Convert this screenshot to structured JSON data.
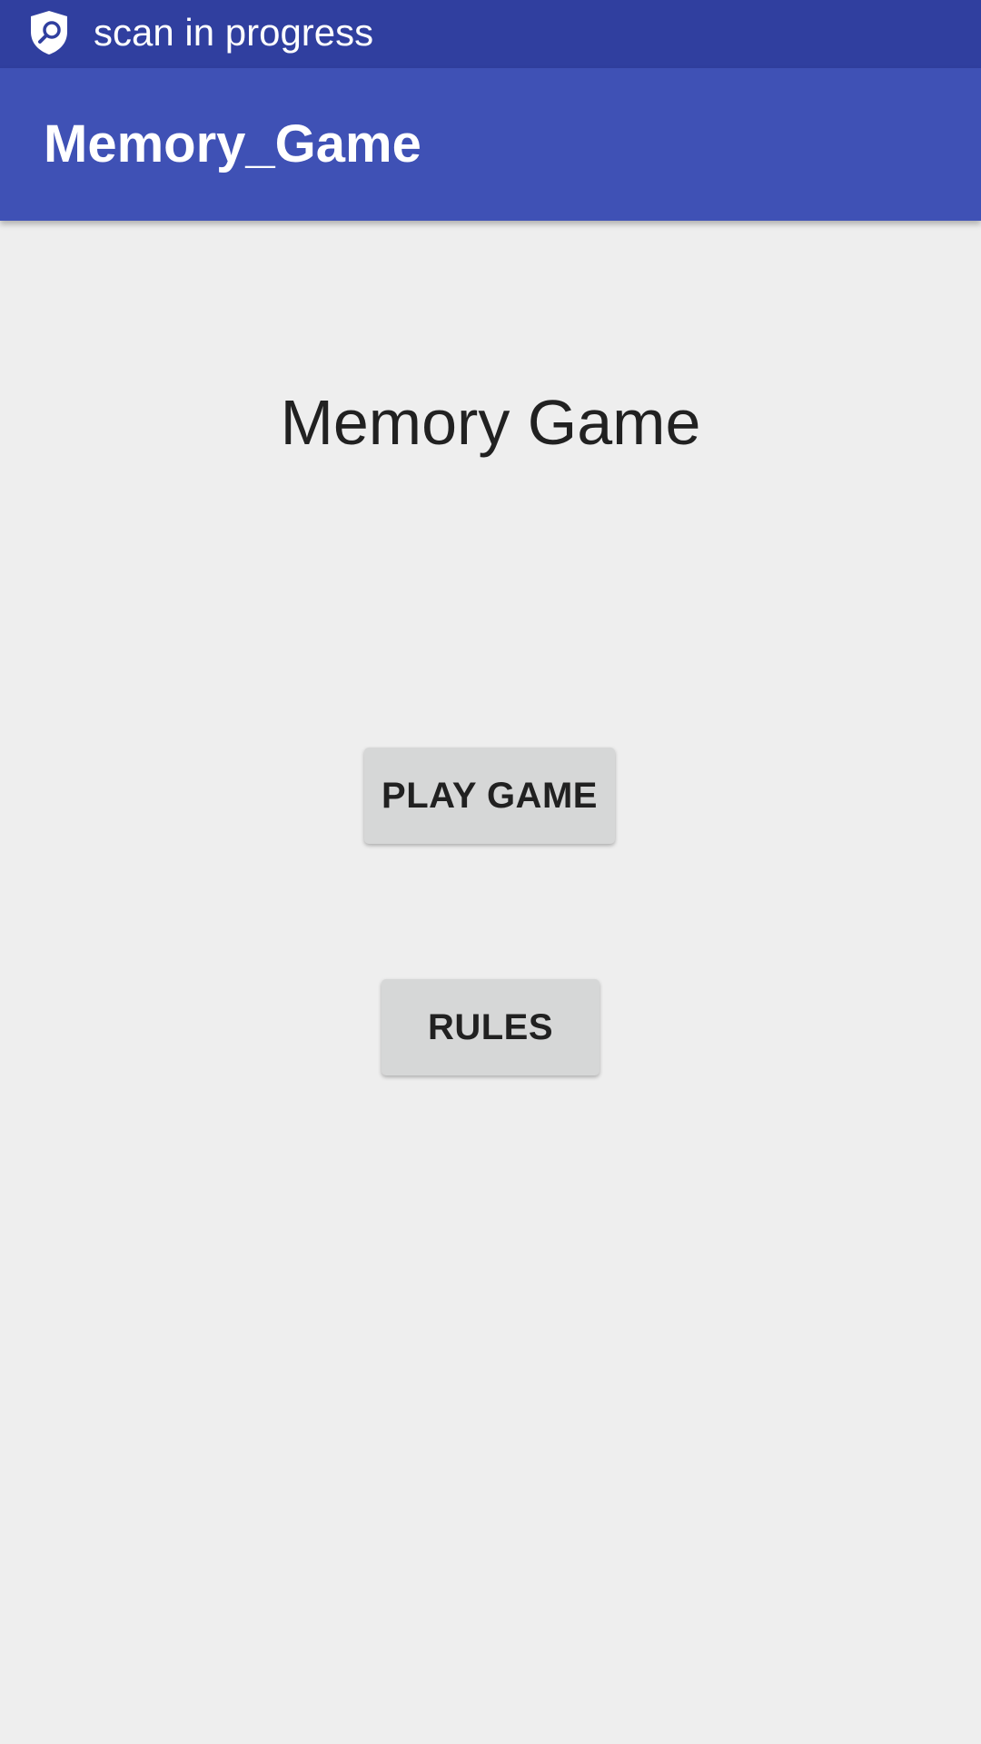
{
  "status_bar": {
    "notification_text": "scan in progress",
    "icon": "shield-search-icon",
    "background": "#303F9F"
  },
  "app_bar": {
    "title": "Memory_Game",
    "background": "#3F51B5"
  },
  "main": {
    "title": "Memory Game",
    "play_button_label": "PLAY GAME",
    "rules_button_label": "RULES"
  }
}
